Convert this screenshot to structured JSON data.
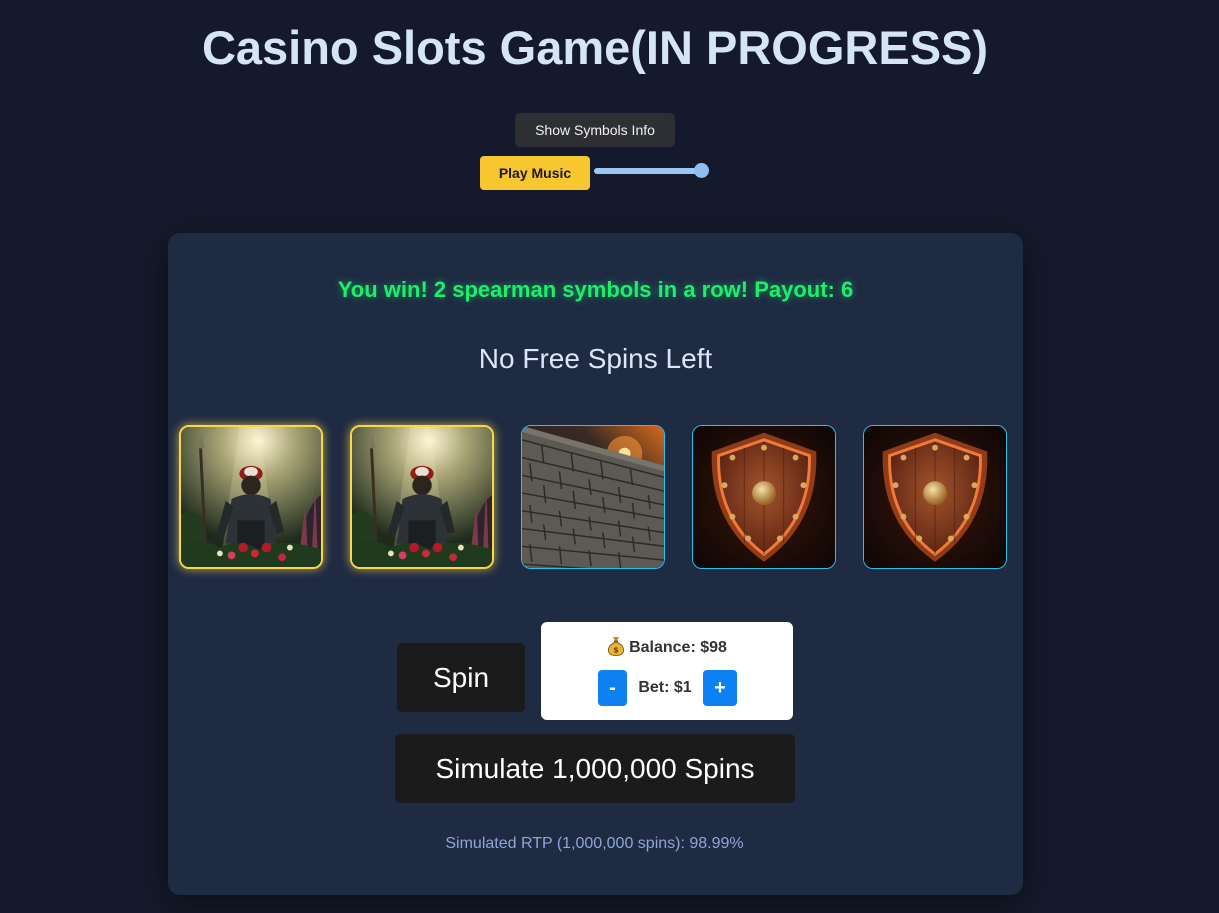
{
  "header": {
    "title": "Casino Slots Game(IN PROGRESS)"
  },
  "controls": {
    "symbols_button": "Show Symbols Info",
    "music_button": "Play Music",
    "volume_level": 1.0
  },
  "game": {
    "win_message": "You win! 2 spearman symbols in a row! Payout: 6",
    "free_spins_status": "No Free Spins Left",
    "reels": [
      {
        "symbol": "spearman",
        "winning": true
      },
      {
        "symbol": "spearman",
        "winning": true
      },
      {
        "symbol": "stone-wall",
        "winning": false
      },
      {
        "symbol": "shield",
        "winning": false
      },
      {
        "symbol": "shield",
        "winning": false
      }
    ],
    "spin_button": "Spin",
    "balance_icon": "money-bag-icon",
    "balance_text": "Balance: $98",
    "bet_minus": "-",
    "bet_text": "Bet: $1",
    "bet_plus": "+",
    "simulate_button": "Simulate 1,000,000 Spins",
    "rtp_text": "Simulated RTP (1,000,000 spins): 98.99%"
  },
  "colors": {
    "background": "#141a2b",
    "panel": "#1f2a43",
    "win_text": "#1cf06a",
    "music_button": "#f8c62f",
    "bet_buttons": "#0d80f2",
    "winning_border": "#f8d84a",
    "reel_border": "#2ec3e6"
  }
}
